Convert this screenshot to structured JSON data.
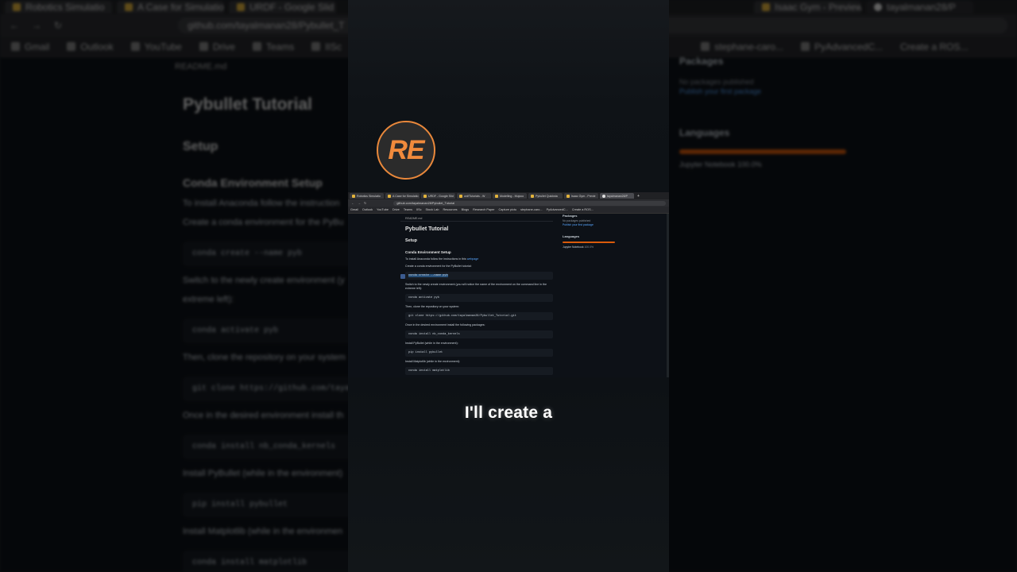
{
  "background": {
    "tabs": [
      {
        "label": "Robotics Simulatio"
      },
      {
        "label": "A Case for Simulatio"
      },
      {
        "label": "URDF - Google Slid"
      },
      {
        "label": "Isaac Gym - Preview"
      },
      {
        "label": "tayalmanan28/P"
      }
    ],
    "url": "github.com/tayalmanan28/Pybullet_T",
    "bookmarks": [
      "Gmail",
      "Outlook",
      "YouTube",
      "Drive",
      "Teams",
      "IISc",
      "St",
      "stephane-caro...",
      "PyAdvancedC...",
      "Create a ROS..."
    ],
    "readme": {
      "file": "README.md",
      "title": "Pybullet Tutorial",
      "setup": "Setup",
      "conda_heading": "Conda Environment Setup",
      "p_install": "To install Anaconda follow the instruction",
      "p_create": "Create a conda environment for the PyBu",
      "code_create": "conda create --name pyb",
      "p_switch": "Switch to the newly create environment (y",
      "p_switch2": "extreme left):",
      "code_activate": "conda activate pyb",
      "p_clone": "Then, clone the repository on your system",
      "code_clone": "git clone https://github.com/tayal",
      "p_once": "Once in the desired environment install th",
      "code_kernels": "conda install nb_conda_kernels",
      "p_pybullet": "Install PyBullet (while in the environment)",
      "code_pybullet": "pip install pybullet",
      "p_matplotlib": "Install Matplotlib (while in the environmen",
      "code_matplotlib": "conda install matplotlib"
    },
    "sidebar": {
      "packages": "Packages",
      "no_packages": "No packages published",
      "publish": "Publish your first package",
      "languages": "Languages",
      "lang_name": "Jupyter Notebook",
      "lang_pct": "100.0%"
    }
  },
  "panel": {
    "logo_text": "RE",
    "caption": "I'll create a",
    "mini": {
      "tabs": [
        {
          "label": "Robotics Simulatio"
        },
        {
          "label": "A Case for Simulatio"
        },
        {
          "label": "URDF - Google Slid"
        },
        {
          "label": "urdfTutorials - W"
        },
        {
          "label": "Modelling - Mujoco"
        },
        {
          "label": "Pybullet Quicksta"
        },
        {
          "label": "Isaac Gym - Previe"
        },
        {
          "label": "tayalmanan28/P"
        }
      ],
      "url": "github.com/tayalmanan28/Pybullet_Tutorial",
      "bookmarks": [
        "Gmail",
        "Outlook",
        "YouTube",
        "Drive",
        "Teams",
        "IISc",
        "Stock Lab",
        "Resources",
        "Blogs",
        "Research Paper",
        "Capture pictu",
        "stephane-caro...",
        "PyAdvancedC...",
        "Create a ROS..."
      ],
      "readme": {
        "file": "README.md",
        "title": "Pybullet Tutorial",
        "setup": "Setup",
        "conda_heading": "Conda Environment Setup",
        "p_install": "To install Anaconda follow the instructions in this",
        "p_install_link": "webpage",
        "p_create": "Create a conda environment for the PyBullet tutorial:",
        "code_create": "conda create --name pyb",
        "p_switch": "Switch to the newly create environment (you will notice the name of the environment on the command line in the extreme left):",
        "code_activate": "conda activate pyb",
        "p_clone": "Then, clone the repository on your system:",
        "code_clone": "git clone https://github.com/tayalmanan28/Pybullet_Tutorial.git",
        "p_once": "Once in the desired environment install the following packages:",
        "code_kernels": "conda install nb_conda_kernels",
        "p_pybullet": "Install PyBullet (while in the environment):",
        "code_pybullet": "pip install pybullet",
        "p_matplotlib": "Install Matplotlib (while in the environment):",
        "code_matplotlib": "conda install matplotlib"
      },
      "sidebar": {
        "packages": "Packages",
        "no_packages": "No packages published",
        "publish": "Publish your first package",
        "languages": "Languages",
        "lang_name": "Jupyter Notebook",
        "lang_pct": "100.0%"
      }
    }
  }
}
